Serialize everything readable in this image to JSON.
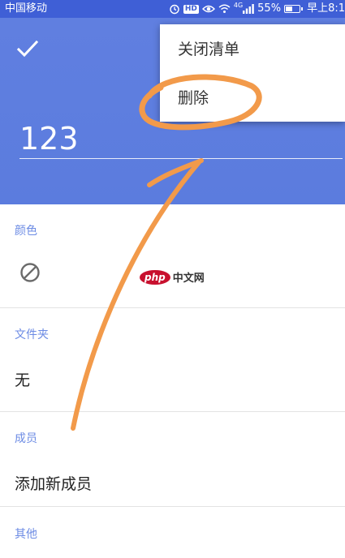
{
  "status_bar": {
    "carrier": "中国移动",
    "hd": "HD",
    "network": "4G",
    "battery_percent": "55%",
    "battery_level": 0.55,
    "time": "早上8:1"
  },
  "header": {
    "title_value": "123",
    "background_color": "#5b7fe0"
  },
  "menu": {
    "items": [
      {
        "label": "关闭清单"
      },
      {
        "label": "删除"
      }
    ]
  },
  "sections": {
    "color": {
      "label": "颜色",
      "icon": "no-color-icon"
    },
    "folder": {
      "label": "文件夹",
      "value": "无"
    },
    "members": {
      "label": "成员",
      "value": "添加新成员"
    },
    "other": {
      "label": "其他"
    }
  },
  "watermark": {
    "brand": "php",
    "text": "中文网"
  },
  "colors": {
    "accent": "#5b7fe0",
    "section_label": "#6c8be4",
    "annotation": "#f29a4a"
  }
}
